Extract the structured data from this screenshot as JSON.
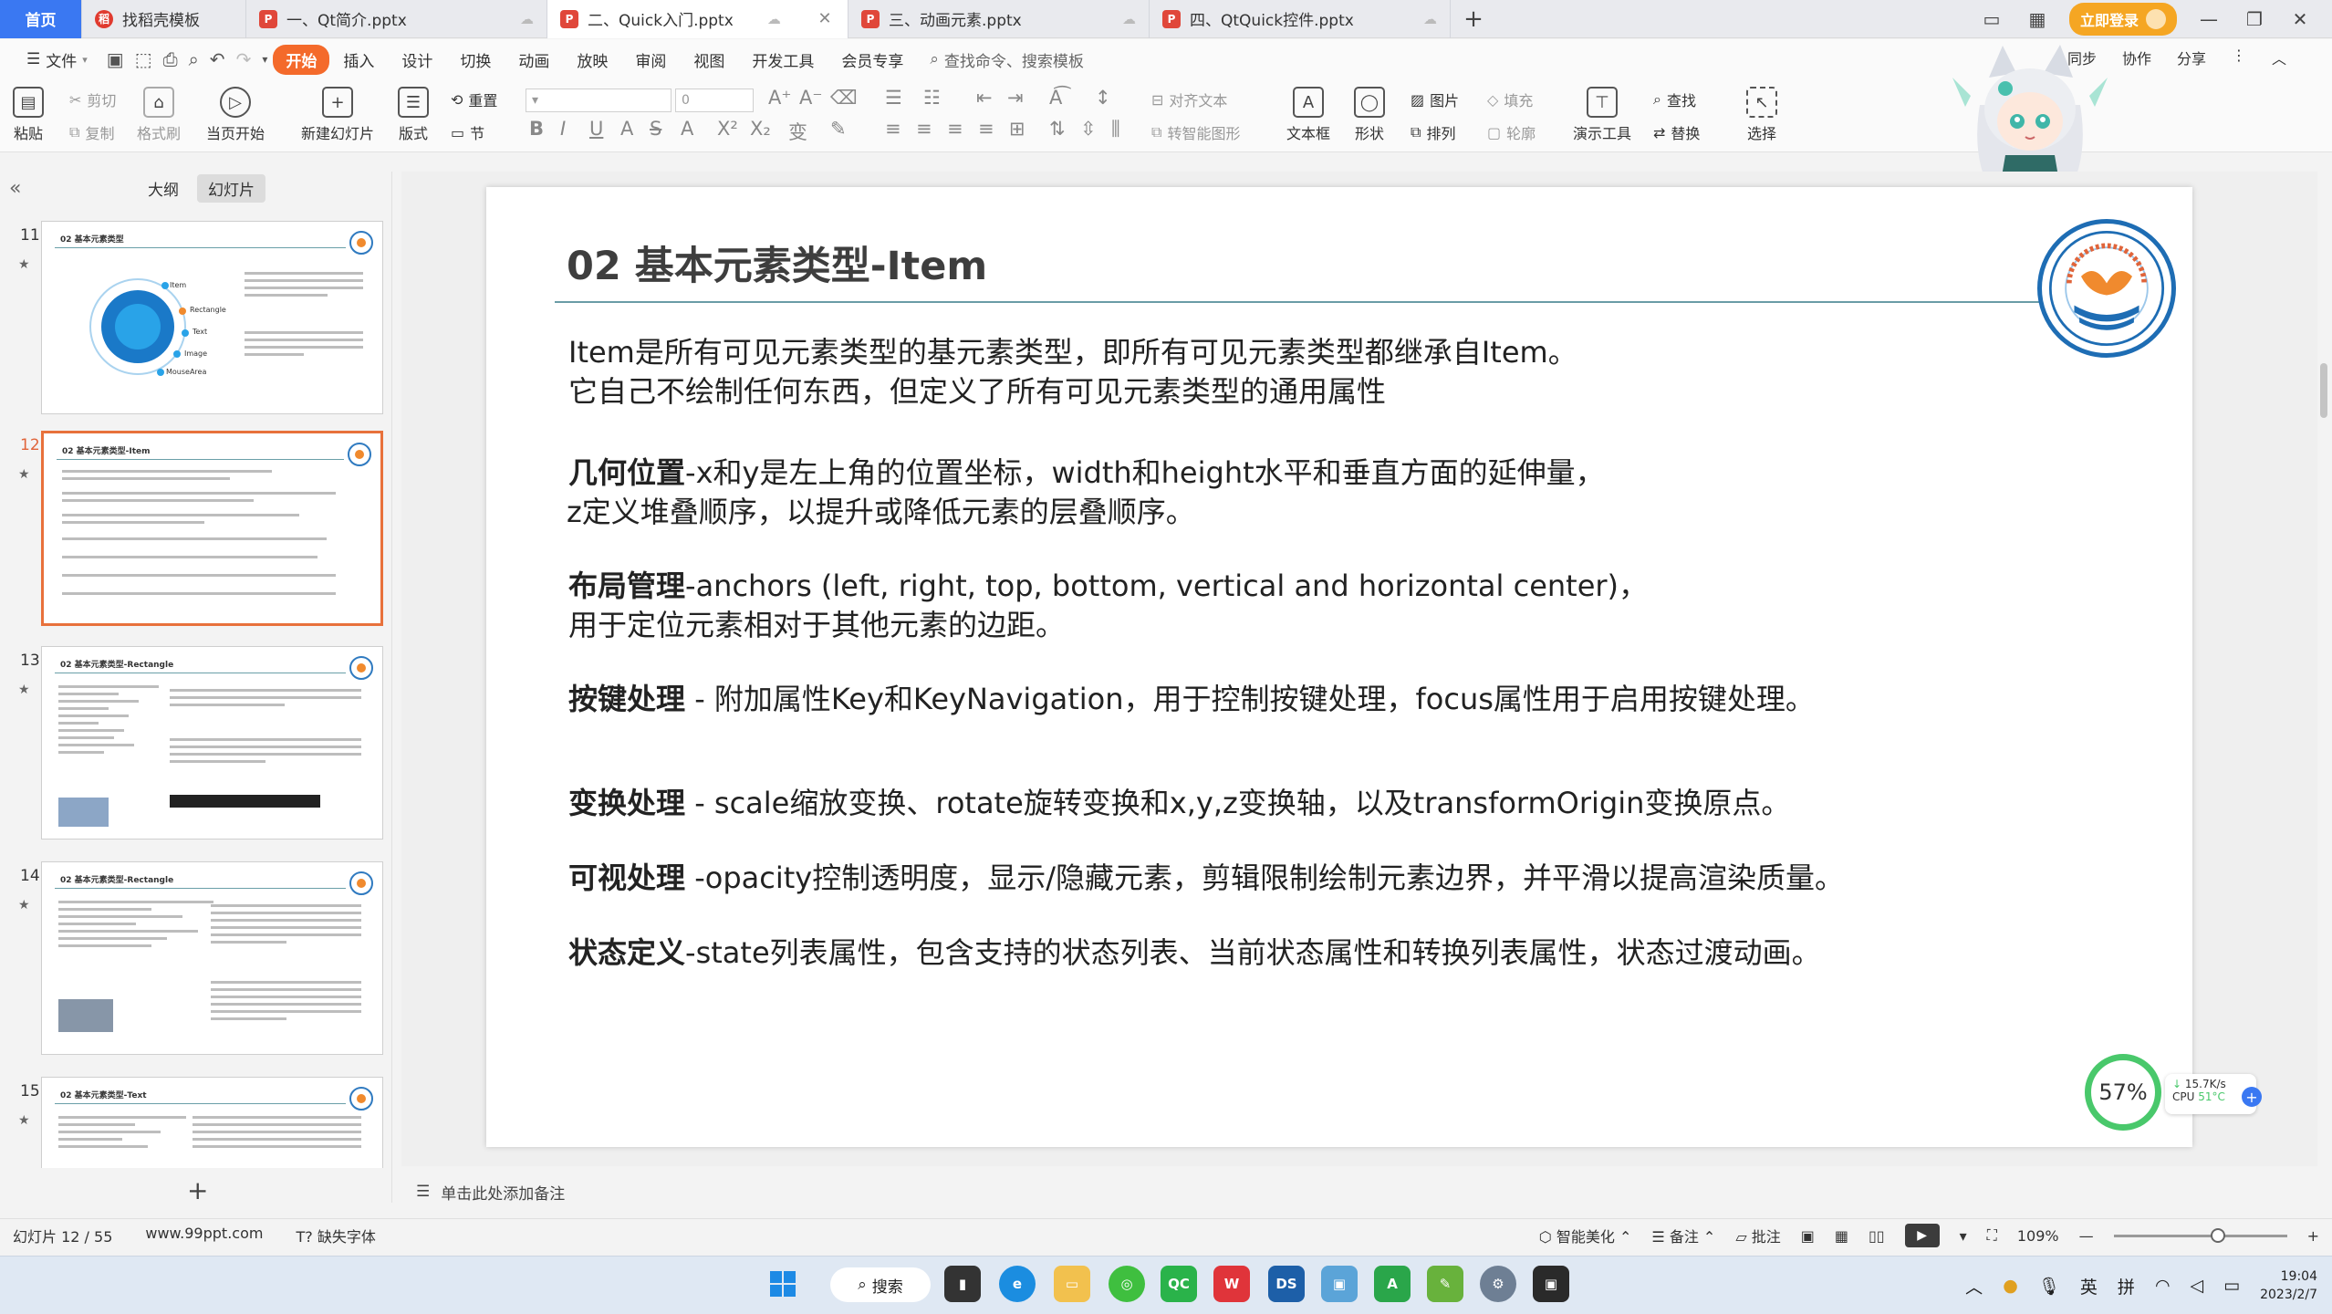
{
  "tabs": {
    "home": "首页",
    "template": "找稻壳模板",
    "docs": [
      {
        "label": "一、Qt简介.pptx"
      },
      {
        "label": "二、Quick入门.pptx"
      },
      {
        "label": "三、动画元素.pptx"
      },
      {
        "label": "四、QtQuick控件.pptx"
      }
    ],
    "login": "立即登录"
  },
  "menu": {
    "file": "文件",
    "items": [
      "开始",
      "插入",
      "设计",
      "切换",
      "动画",
      "放映",
      "审阅",
      "视图",
      "开发工具",
      "会员专享"
    ],
    "search": "查找命令、搜索模板",
    "right": [
      "同步",
      "协作",
      "分享"
    ]
  },
  "ribbon": {
    "paste": "粘贴",
    "cut": "剪切",
    "copy": "复制",
    "format_painter": "格式刷",
    "from_current": "当页开始",
    "new_slide": "新建幻灯片",
    "layout": "版式",
    "reset": "重置",
    "section": "节",
    "font_size": "0",
    "align_text": "对齐文本",
    "smart_shape": "转智能图形",
    "textbox": "文本框",
    "shape": "形状",
    "picture": "图片",
    "arrange": "排列",
    "fill": "填充",
    "outline": "轮廓",
    "present_tools": "演示工具",
    "find": "查找",
    "replace": "替换",
    "select": "选择"
  },
  "left_panel": {
    "outline_tab": "大纲",
    "slides_tab": "幻灯片",
    "thumbs": [
      {
        "num": "11",
        "title": "02 基本元素类型"
      },
      {
        "num": "12",
        "title": "02 基本元素类型-Item"
      },
      {
        "num": "13",
        "title": "02 基本元素类型-Rectangle"
      },
      {
        "num": "14",
        "title": "02 基本元素类型-Rectangle"
      },
      {
        "num": "15",
        "title": "02 基本元素类型-Text"
      }
    ],
    "thumb11_labels": [
      "Item",
      "Rectangle",
      "Text",
      "Image",
      "MouseArea"
    ]
  },
  "slide": {
    "title": "02 基本元素类型-Item",
    "intro1": "Item是所有可见元素类型的基元素类型，即所有可见元素类型都继承自Item。",
    "intro2": "它自己不绘制任何东西，但定义了所有可见元素类型的通用属性",
    "geo_head": "几何位置",
    "geo_text1": "-x和y是左上角的位置坐标，width和height水平和垂直方面的延伸量，",
    "geo_text2": "z定义堆叠顺序，以提升或降低元素的层叠顺序。",
    "layout_head": "布局管理",
    "layout_text1": "-anchors (left, right, top, bottom, vertical and horizontal center)，",
    "layout_text2": "用于定位元素相对于其他元素的边距。",
    "key_head": "按键处理",
    "key_text": " - 附加属性Key和KeyNavigation，用于控制按键处理，focus属性用于启用按键处理。",
    "transform_head": "变换处理",
    "transform_text": " - scale缩放变换、rotate旋转变换和x,y,z变换轴，以及transformOrigin变换原点。",
    "visual_head": "可视处理",
    "visual_text": " -opacity控制透明度，显示/隐藏元素，剪辑限制绘制元素边界，并平滑以提高渲染质量。",
    "state_head": "状态定义",
    "state_text": "-state列表属性，包含支持的状态列表、当前状态属性和转换列表属性，状态过渡动画。"
  },
  "notes_placeholder": "单击此处添加备注",
  "perf": {
    "percent": "57%",
    "net": "15.7K/s",
    "cpu_label": "CPU",
    "cpu_temp": "51°C"
  },
  "status": {
    "slide_pos": "幻灯片 12 / 55",
    "site": "www.99ppt.com",
    "missing_font": "缺失字体",
    "beautify": "智能美化",
    "notes": "备注",
    "comments": "批注",
    "zoom": "109%",
    "zoom_fraction": 0.6
  },
  "taskbar": {
    "search": "搜索",
    "ime_lang": "英",
    "ime_mode": "拼",
    "time": "19:04",
    "date": "2023/2/7"
  },
  "colors": {
    "accent": "#f46a2b",
    "home_tab": "#3a78f2",
    "slide_rule": "#6a9ca6",
    "active_thumb": "#e8713b",
    "logo_blue": "#1e6db4",
    "logo_orange": "#f08a2e"
  }
}
